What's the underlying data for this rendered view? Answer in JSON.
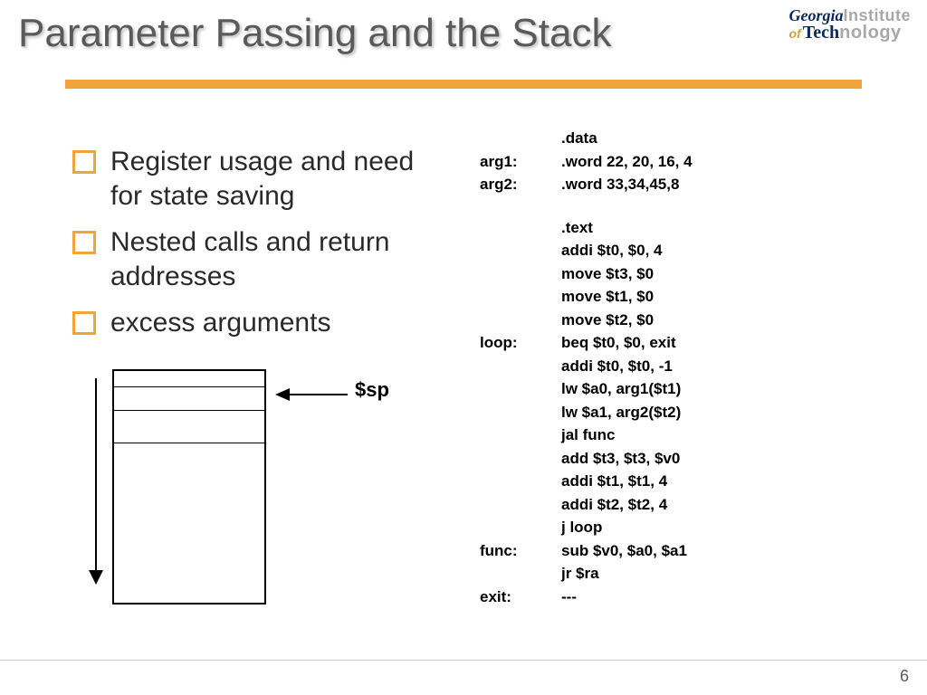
{
  "title": "Parameter Passing and the Stack",
  "logo": {
    "georgia": "Georgia",
    "institute": "Institute",
    "of": "of",
    "tech": "Tech",
    "nology": "nology"
  },
  "bullets": [
    "Register usage and need for state saving",
    "Nested calls and return addresses",
    "excess arguments"
  ],
  "sp_label": "$sp",
  "code": [
    {
      "label": "",
      "instr": ".data"
    },
    {
      "label": "arg1:",
      "instr": ".word 22, 20, 16, 4"
    },
    {
      "label": "arg2:",
      "instr": ".word 33,34,45,8"
    },
    {
      "gap": true
    },
    {
      "label": "",
      "instr": ".text"
    },
    {
      "label": "",
      "instr": "addi $t0, $0, 4"
    },
    {
      "label": "",
      "instr": "move $t3, $0"
    },
    {
      "label": "",
      "instr": "move $t1, $0"
    },
    {
      "label": "",
      "instr": "move $t2, $0"
    },
    {
      "label": "loop:",
      "instr": "beq $t0, $0, exit"
    },
    {
      "label": "",
      "instr": "addi  $t0, $t0, -1"
    },
    {
      "label": "",
      "instr": "lw $a0, arg1($t1)"
    },
    {
      "label": "",
      "instr": "lw $a1, arg2($t2)"
    },
    {
      "label": "",
      "instr": "jal func"
    },
    {
      "label": "",
      "instr": "add $t3, $t3, $v0"
    },
    {
      "label": "",
      "instr": "addi $t1, $t1, 4"
    },
    {
      "label": "",
      "instr": "addi $t2, $t2, 4"
    },
    {
      "label": "",
      "instr": "j loop"
    },
    {
      "label": "func:",
      "instr": "sub $v0, $a0, $a1"
    },
    {
      "label": "",
      "instr": "jr $ra"
    },
    {
      "label": "exit:",
      "instr": "---"
    }
  ],
  "page_number": "6"
}
